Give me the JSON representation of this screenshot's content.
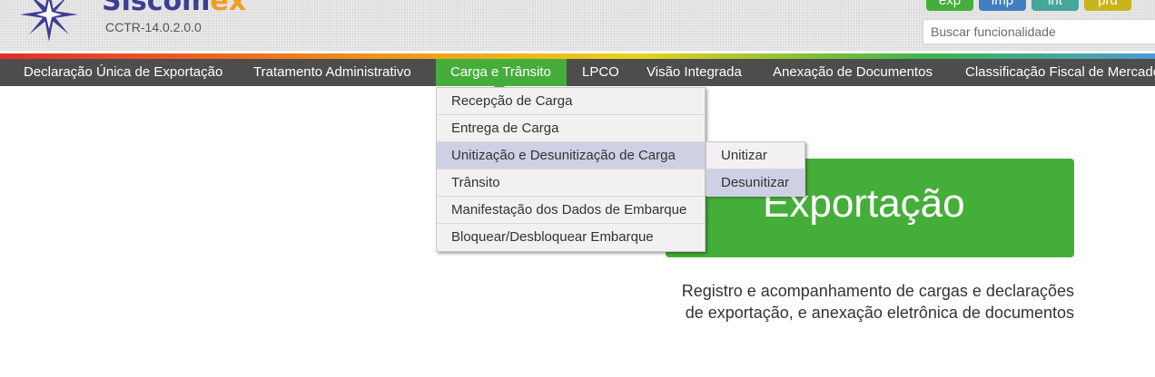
{
  "header": {
    "logo": {
      "text_part1": "Siscom",
      "text_part2": "ex",
      "star_icon": "compass-star-icon"
    },
    "version": "CCTR-14.0.2.0.0",
    "environments": [
      "exp",
      "imp",
      "int",
      "prd"
    ],
    "search": {
      "placeholder": "Buscar funcionalidade"
    },
    "colors": {
      "green": "#45ae3a",
      "navy": "#3b3f93",
      "orange": "#f39c1f",
      "nav_bg": "#4d4d4d"
    }
  },
  "nav": {
    "items": [
      "Declaração Única de Exportação",
      "Tratamento Administrativo",
      "Carga e Trânsito",
      "LPCO",
      "Visão Integrada",
      "Anexação de Documentos",
      "Classificação Fiscal de Mercado"
    ],
    "active": "Carga e Trânsito"
  },
  "dropdown": {
    "items": [
      "Recepção de Carga",
      "Entrega de Carga",
      "Unitização e Desunitização de Carga",
      "Trânsito",
      "Manifestação dos Dados de Embarque",
      "Bloquear/Desbloquear Embarque"
    ],
    "highlighted": "Unitização e Desunitização de Carga",
    "submenu": {
      "items": [
        "Unitizar",
        "Desunitizar"
      ],
      "highlighted": "Desunitizar"
    }
  },
  "main": {
    "hero_title": "Exportação",
    "description_line1": "Registro e acompanhamento de cargas e declarações",
    "description_line2": "de exportação, e anexação eletrônica de documentos"
  }
}
